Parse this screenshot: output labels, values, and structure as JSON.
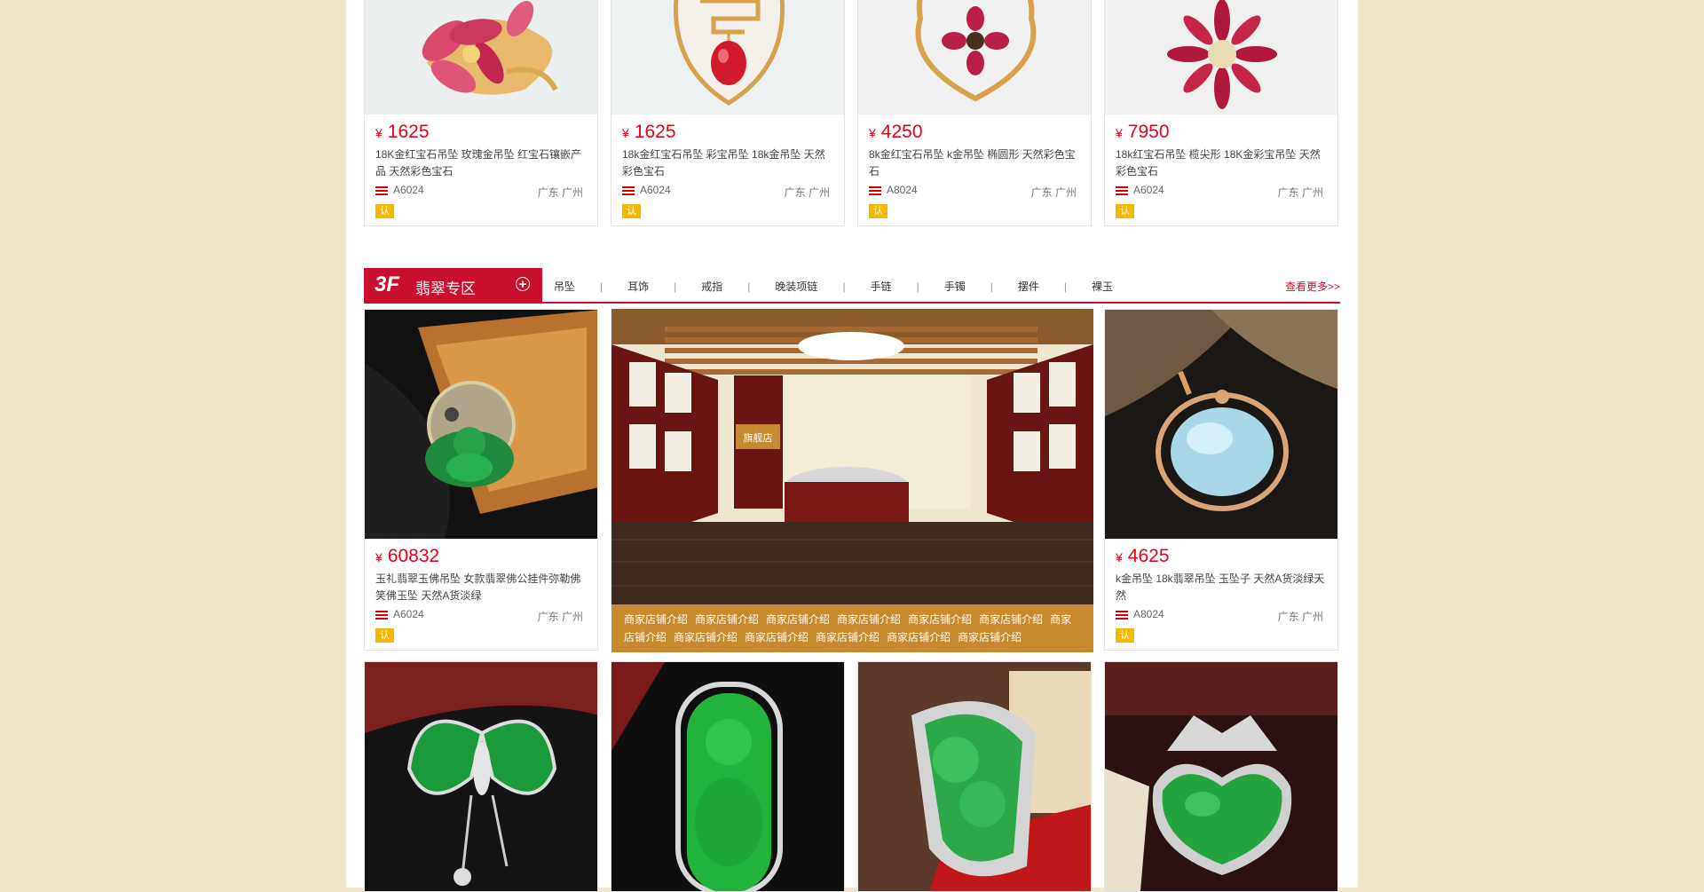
{
  "top_products": [
    {
      "currency": "¥",
      "price": "1625",
      "title": "18K金红宝石吊坠 玫瑰金吊坠 红宝石镶嵌产品 天然彩色宝石",
      "code": "A6024",
      "location": "广东 广州",
      "badge": "认"
    },
    {
      "currency": "¥",
      "price": "1625",
      "title": "18k金红宝石吊坠 彩宝吊坠 18k金吊坠 天然彩色宝石",
      "code": "A6024",
      "location": "广东 广州",
      "badge": "认"
    },
    {
      "currency": "¥",
      "price": "4250",
      "title": "8k金红宝石吊坠 k金吊坠 椭圆形 天然彩色宝石",
      "code": "A8024",
      "location": "广东 广州",
      "badge": "认"
    },
    {
      "currency": "¥",
      "price": "7950",
      "title": "18k红宝石吊坠 榄尖形 18K金彩宝吊坠 天然彩色宝石",
      "code": "A6024",
      "location": "广东 广州",
      "badge": "认"
    }
  ],
  "floor": {
    "number": "3F",
    "name": "翡翠专区",
    "tabs": [
      "吊坠",
      "耳饰",
      "戒指",
      "晚装项链",
      "手链",
      "手镯",
      "摆件",
      "裸玉"
    ],
    "more": "查看更多>>"
  },
  "jade_products": [
    {
      "currency": "¥",
      "price": "60832",
      "title": "玉礼翡翠玉佛吊坠 女款翡翠佛公挂件弥勒佛笑佛玉坠 天然A货淡绿",
      "code": "A6024",
      "location": "广东 广州",
      "badge": "认"
    },
    {
      "currency": "¥",
      "price": "4625",
      "title": "k金吊坠 18k翡翠吊坠 玉坠子 天然A货淡绿天然",
      "code": "A8024",
      "location": "广东 广州",
      "badge": "认"
    }
  ],
  "shop_banner": {
    "sign_text": "旗舰店",
    "captions": [
      "商家店铺介绍",
      "商家店铺介绍",
      "商家店铺介绍",
      "商家店铺介绍",
      "商家店铺介绍",
      "商家店铺介绍",
      "商家店铺介绍",
      "商家店铺介绍",
      "商家店铺介绍",
      "商家店铺介绍",
      "商家店铺介绍",
      "商家店铺介绍"
    ]
  },
  "colors": {
    "accent": "#c8102e",
    "price": "#e5001c",
    "badge": "#f5b800",
    "page_bg": "#f0e7cc",
    "caption_bg": "#c9892e"
  }
}
